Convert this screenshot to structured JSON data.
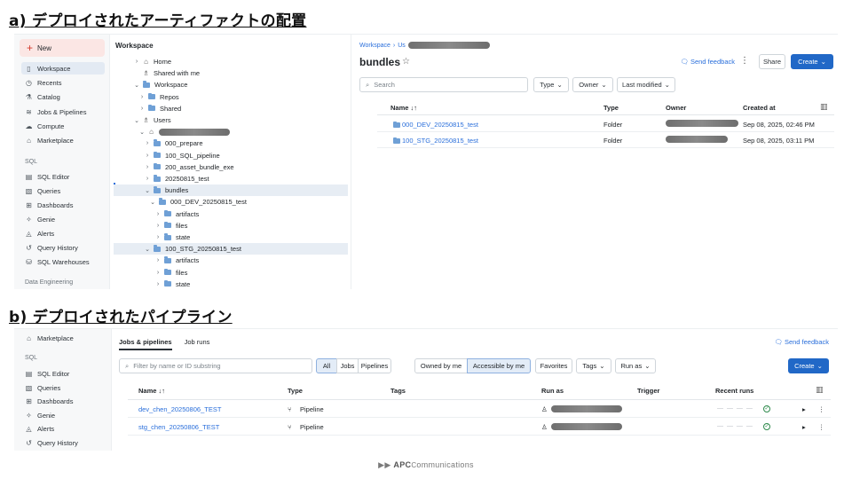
{
  "headings": {
    "a": "a) デプロイされたアーティファクトの配置",
    "b": "b) デプロイされたパイプライン"
  },
  "shotA": {
    "sidebar": {
      "new_label": "New",
      "items": [
        {
          "label": "Workspace",
          "icon": "folder-icon"
        },
        {
          "label": "Recents",
          "icon": "clock-icon"
        },
        {
          "label": "Catalog",
          "icon": "catalog-icon"
        },
        {
          "label": "Jobs & Pipelines",
          "icon": "jobs-icon"
        },
        {
          "label": "Compute",
          "icon": "cloud-icon"
        },
        {
          "label": "Marketplace",
          "icon": "store-icon"
        }
      ],
      "sql_section": "SQL",
      "sql_items": [
        {
          "label": "SQL Editor",
          "icon": "editor-icon"
        },
        {
          "label": "Queries",
          "icon": "queries-icon"
        },
        {
          "label": "Dashboards",
          "icon": "dashboard-icon"
        },
        {
          "label": "Genie",
          "icon": "genie-icon"
        },
        {
          "label": "Alerts",
          "icon": "bell-icon"
        },
        {
          "label": "Query History",
          "icon": "history-icon"
        },
        {
          "label": "SQL Warehouses",
          "icon": "warehouse-icon"
        }
      ],
      "de_section": "Data Engineering"
    },
    "tree": {
      "title": "Workspace",
      "nodes": [
        {
          "label": "Home",
          "chev": "›",
          "kind": "home"
        },
        {
          "label": "Shared with me",
          "chev": "",
          "kind": "shared"
        },
        {
          "label": "Workspace",
          "chev": "⌄",
          "kind": "folder"
        },
        {
          "label": "Repos",
          "chev": "›",
          "kind": "folder"
        },
        {
          "label": "Shared",
          "chev": "›",
          "kind": "folder"
        },
        {
          "label": "Users",
          "chev": "⌄",
          "kind": "users"
        },
        {
          "label": "",
          "chev": "⌄",
          "kind": "home-redacted"
        },
        {
          "label": "000_prepare",
          "chev": "›",
          "kind": "folder"
        },
        {
          "label": "100_SQL_pipeline",
          "chev": "›",
          "kind": "folder"
        },
        {
          "label": "200_asset_bundle_exe",
          "chev": "›",
          "kind": "folder"
        },
        {
          "label": "20250815_test",
          "chev": "›",
          "kind": "folder"
        },
        {
          "label": "bundles",
          "chev": "⌄",
          "kind": "folder"
        },
        {
          "label": "000_DEV_20250815_test",
          "chev": "⌄",
          "kind": "folder"
        },
        {
          "label": "artifacts",
          "chev": "›",
          "kind": "folder"
        },
        {
          "label": "files",
          "chev": "›",
          "kind": "folder"
        },
        {
          "label": "state",
          "chev": "›",
          "kind": "folder"
        },
        {
          "label": "100_STG_20250815_test",
          "chev": "⌄",
          "kind": "folder"
        },
        {
          "label": "artifacts",
          "chev": "›",
          "kind": "folder"
        },
        {
          "label": "files",
          "chev": "›",
          "kind": "folder"
        },
        {
          "label": "state",
          "chev": "›",
          "kind": "folder"
        }
      ]
    },
    "main": {
      "breadcrumb_root": "Workspace",
      "breadcrumb_sep": "›",
      "breadcrumb_next": "Us",
      "title": "bundles",
      "star": "☆",
      "feedback": "Send feedback",
      "share": "Share",
      "create": "Create",
      "search_placeholder": "Search",
      "filters": [
        "Type",
        "Owner",
        "Last modified"
      ],
      "columns": {
        "name": "Name ↓↑",
        "type": "Type",
        "owner": "Owner",
        "created": "Created at"
      },
      "rows": [
        {
          "name": "000_DEV_20250815_test",
          "type": "Folder",
          "created": "Sep 08, 2025, 02:46 PM"
        },
        {
          "name": "100_STG_20250815_test",
          "type": "Folder",
          "created": "Sep 08, 2025, 03:11 PM"
        }
      ]
    }
  },
  "shotB": {
    "sidebar": {
      "marketplace": "Marketplace",
      "sql_section": "SQL",
      "items": [
        "SQL Editor",
        "Queries",
        "Dashboards",
        "Genie",
        "Alerts",
        "Query History"
      ]
    },
    "main": {
      "tabs": [
        "Jobs & pipelines",
        "Job runs"
      ],
      "feedback": "Send feedback",
      "search_placeholder": "Filter by name or ID substring",
      "segments": [
        "All",
        "Jobs",
        "Pipelines"
      ],
      "owner_filters": [
        "Owned by me",
        "Accessible by me"
      ],
      "other_filters": [
        "Favorites",
        "Tags",
        "Run as"
      ],
      "create": "Create",
      "columns": {
        "name": "Name ↓↑",
        "type": "Type",
        "tags": "Tags",
        "run_as": "Run as",
        "trigger": "Trigger",
        "recent": "Recent runs"
      },
      "rows": [
        {
          "name": "dev_chen_20250806_TEST",
          "type": "Pipeline"
        },
        {
          "name": "stg_chen_20250806_TEST",
          "type": "Pipeline"
        }
      ]
    }
  },
  "footer": {
    "brand_strong": "APC",
    "brand_rest": "ommunications",
    "arrows": "▶▶"
  }
}
